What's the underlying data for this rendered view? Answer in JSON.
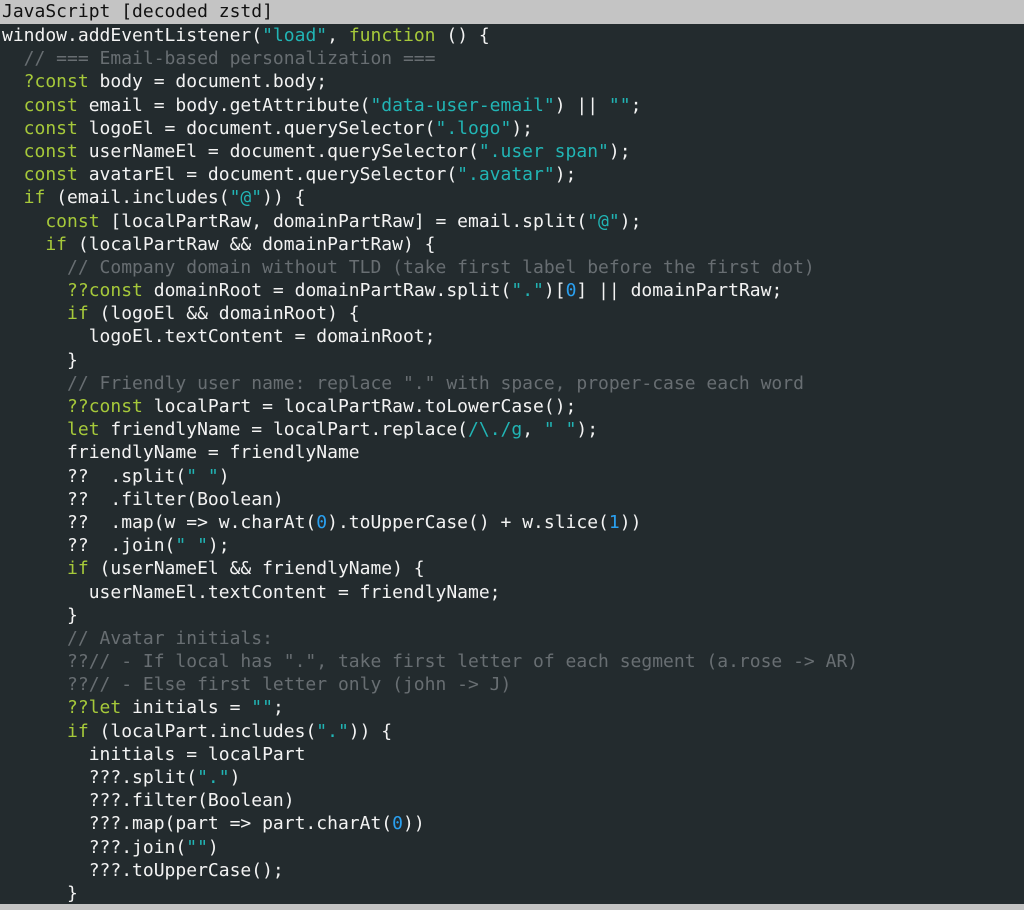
{
  "window": {
    "title": "JavaScript [decoded zstd]"
  },
  "code_lines": [
    [
      {
        "t": "plain",
        "s": "window.addEventListener("
      },
      {
        "t": "str",
        "s": "\"load\""
      },
      {
        "t": "plain",
        "s": ", "
      },
      {
        "t": "kw",
        "s": "function"
      },
      {
        "t": "plain",
        "s": " () {"
      }
    ],
    [
      {
        "t": "com",
        "s": "  // === Email-based personalization ==="
      }
    ],
    [
      {
        "t": "kw",
        "s": "  ?const"
      },
      {
        "t": "plain",
        "s": " body = document.body;"
      }
    ],
    [
      {
        "t": "kw",
        "s": "  const"
      },
      {
        "t": "plain",
        "s": " email = body.getAttribute("
      },
      {
        "t": "str",
        "s": "\"data-user-email\""
      },
      {
        "t": "plain",
        "s": ") || "
      },
      {
        "t": "str",
        "s": "\"\""
      },
      {
        "t": "plain",
        "s": ";"
      }
    ],
    [
      {
        "t": "kw",
        "s": "  const"
      },
      {
        "t": "plain",
        "s": " logoEl = document.querySelector("
      },
      {
        "t": "str",
        "s": "\".logo\""
      },
      {
        "t": "plain",
        "s": ");"
      }
    ],
    [
      {
        "t": "kw",
        "s": "  const"
      },
      {
        "t": "plain",
        "s": " userNameEl = document.querySelector("
      },
      {
        "t": "str",
        "s": "\".user span\""
      },
      {
        "t": "plain",
        "s": ");"
      }
    ],
    [
      {
        "t": "kw",
        "s": "  const"
      },
      {
        "t": "plain",
        "s": " avatarEl = document.querySelector("
      },
      {
        "t": "str",
        "s": "\".avatar\""
      },
      {
        "t": "plain",
        "s": ");"
      }
    ],
    [
      {
        "t": "kw",
        "s": "  if"
      },
      {
        "t": "plain",
        "s": " (email.includes("
      },
      {
        "t": "str",
        "s": "\"@\""
      },
      {
        "t": "plain",
        "s": ")) {"
      }
    ],
    [
      {
        "t": "kw",
        "s": "    const"
      },
      {
        "t": "plain",
        "s": " [localPartRaw, domainPartRaw] = email.split("
      },
      {
        "t": "str",
        "s": "\"@\""
      },
      {
        "t": "plain",
        "s": ");"
      }
    ],
    [
      {
        "t": "kw",
        "s": "    if"
      },
      {
        "t": "plain",
        "s": " (localPartRaw && domainPartRaw) {"
      }
    ],
    [
      {
        "t": "com",
        "s": "      // Company domain without TLD (take first label before the first dot)"
      }
    ],
    [
      {
        "t": "kw",
        "s": "      ??const"
      },
      {
        "t": "plain",
        "s": " domainRoot = domainPartRaw.split("
      },
      {
        "t": "str",
        "s": "\".\""
      },
      {
        "t": "plain",
        "s": ")["
      },
      {
        "t": "num",
        "s": "0"
      },
      {
        "t": "plain",
        "s": "] || domainPartRaw;"
      }
    ],
    [
      {
        "t": "kw",
        "s": "      if"
      },
      {
        "t": "plain",
        "s": " (logoEl && domainRoot) {"
      }
    ],
    [
      {
        "t": "plain",
        "s": "        logoEl.textContent = domainRoot;"
      }
    ],
    [
      {
        "t": "plain",
        "s": "      }"
      }
    ],
    [
      {
        "t": "com",
        "s": "      // Friendly user name: replace \".\" with space, proper-case each word"
      }
    ],
    [
      {
        "t": "kw",
        "s": "      ??const"
      },
      {
        "t": "plain",
        "s": " localPart = localPartRaw.toLowerCase();"
      }
    ],
    [
      {
        "t": "kw",
        "s": "      let"
      },
      {
        "t": "plain",
        "s": " friendlyName = localPart.replace("
      },
      {
        "t": "str",
        "s": "/\\./g"
      },
      {
        "t": "plain",
        "s": ", "
      },
      {
        "t": "str",
        "s": "\" \""
      },
      {
        "t": "plain",
        "s": ");"
      }
    ],
    [
      {
        "t": "plain",
        "s": "      friendlyName = friendlyName"
      }
    ],
    [
      {
        "t": "plain",
        "s": "      ??  .split("
      },
      {
        "t": "str",
        "s": "\" \""
      },
      {
        "t": "plain",
        "s": ")"
      }
    ],
    [
      {
        "t": "plain",
        "s": "      ??  .filter(Boolean)"
      }
    ],
    [
      {
        "t": "plain",
        "s": "      ??  .map(w => w.charAt("
      },
      {
        "t": "num",
        "s": "0"
      },
      {
        "t": "plain",
        "s": ").toUpperCase() + w.slice("
      },
      {
        "t": "num",
        "s": "1"
      },
      {
        "t": "plain",
        "s": "))"
      }
    ],
    [
      {
        "t": "plain",
        "s": "      ??  .join("
      },
      {
        "t": "str",
        "s": "\" \""
      },
      {
        "t": "plain",
        "s": ");"
      }
    ],
    [
      {
        "t": "kw",
        "s": "      if"
      },
      {
        "t": "plain",
        "s": " (userNameEl && friendlyName) {"
      }
    ],
    [
      {
        "t": "plain",
        "s": "        userNameEl.textContent = friendlyName;"
      }
    ],
    [
      {
        "t": "plain",
        "s": "      }"
      }
    ],
    [
      {
        "t": "com",
        "s": "      // Avatar initials:"
      }
    ],
    [
      {
        "t": "com",
        "s": "      ??// - If local has \".\", take first letter of each segment (a.rose -> AR)"
      }
    ],
    [
      {
        "t": "com",
        "s": "      ??// - Else first letter only (john -> J)"
      }
    ],
    [
      {
        "t": "kw",
        "s": "      ??let"
      },
      {
        "t": "plain",
        "s": " initials = "
      },
      {
        "t": "str",
        "s": "\"\""
      },
      {
        "t": "plain",
        "s": ";"
      }
    ],
    [
      {
        "t": "kw",
        "s": "      if"
      },
      {
        "t": "plain",
        "s": " (localPart.includes("
      },
      {
        "t": "str",
        "s": "\".\""
      },
      {
        "t": "plain",
        "s": ")) {"
      }
    ],
    [
      {
        "t": "plain",
        "s": "        initials = localPart"
      }
    ],
    [
      {
        "t": "plain",
        "s": "        ???.split("
      },
      {
        "t": "str",
        "s": "\".\""
      },
      {
        "t": "plain",
        "s": ")"
      }
    ],
    [
      {
        "t": "plain",
        "s": "        ???.filter(Boolean)"
      }
    ],
    [
      {
        "t": "plain",
        "s": "        ???.map(part => part.charAt("
      },
      {
        "t": "num",
        "s": "0"
      },
      {
        "t": "plain",
        "s": "))"
      }
    ],
    [
      {
        "t": "plain",
        "s": "        ???.join("
      },
      {
        "t": "str",
        "s": "\"\""
      },
      {
        "t": "plain",
        "s": ")"
      }
    ],
    [
      {
        "t": "plain",
        "s": "        ???.toUpperCase();"
      }
    ],
    [
      {
        "t": "plain",
        "s": "      }"
      }
    ]
  ],
  "colors": {
    "background": "#232b2e",
    "plain": "#f3f3f3",
    "keyword": "#a6c93a",
    "string": "#21b5b5",
    "number": "#2aa0f0",
    "comment": "#686e72",
    "titlebar": "#c4c4c4"
  }
}
